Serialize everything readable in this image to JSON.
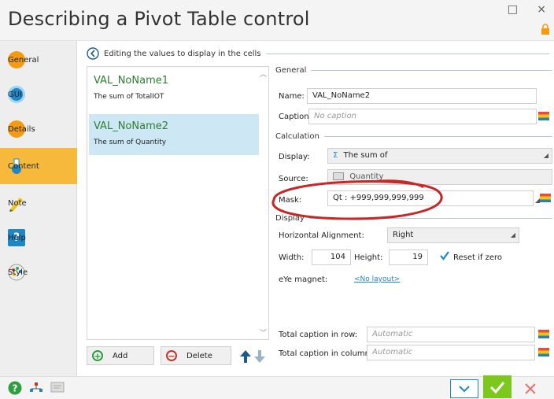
{
  "window": {
    "title": "Describing a Pivot Table control",
    "minimize_icon": "□",
    "close_icon": "×"
  },
  "sidebar": {
    "items": [
      {
        "label": "General",
        "icon": "general-icon",
        "color": "#f39c12"
      },
      {
        "label": "GUI",
        "icon": "gui-icon",
        "color": "#1e88c7"
      },
      {
        "label": "Details",
        "icon": "details-icon",
        "color": "#f39c12"
      },
      {
        "label": "Content",
        "icon": "content-icon",
        "color": "#1e88c7"
      },
      {
        "label": "Note",
        "icon": "note-icon",
        "color": "#f1c40f"
      },
      {
        "label": "Help",
        "icon": "help-icon",
        "color": "#1e88c7"
      },
      {
        "label": "Style",
        "icon": "style-icon",
        "color": "#cccccc"
      }
    ],
    "active_index": 3
  },
  "main": {
    "section_title": "Editing the values to display in the cells",
    "list": [
      {
        "name": "VAL_NoName1",
        "desc": "The sum of TotalIOT"
      },
      {
        "name": "VAL_NoName2",
        "desc": "The sum of Quantity"
      }
    ],
    "selected_index": 1,
    "buttons": {
      "add": "Add",
      "delete": "Delete"
    }
  },
  "panel": {
    "general": {
      "heading": "General",
      "name_label": "Name:",
      "name_value": "VAL_NoName2",
      "caption_label": "Caption:",
      "caption_placeholder": "No caption"
    },
    "calculation": {
      "heading": "Calculation",
      "display_label": "Display:",
      "display_value": "The sum of",
      "display_symbol": "Σ",
      "source_label": "Source:",
      "source_value": "Quantity",
      "mask_label": "Mask:",
      "mask_value": "Qt : +999,999,999,999"
    },
    "display": {
      "heading": "Display",
      "halign_label": "Horizontal Alignment:",
      "halign_value": "Right",
      "width_label": "Width:",
      "width_value": "104",
      "height_label": "Height:",
      "height_value": "19",
      "reset_label": "Reset if zero",
      "eye_label": "eYe magnet:",
      "eye_link": "<No layout>"
    },
    "total_row_label": "Total caption in row:",
    "total_row_placeholder": "Automatic",
    "total_col_label": "Total caption in column:",
    "total_col_placeholder": "Automatic"
  },
  "colors": {
    "accent": "#f6b93b",
    "selection": "#cde8f4",
    "ok_green": "#7dc81e",
    "annotation_red": "#c62828",
    "link_blue": "#1e88c7"
  }
}
